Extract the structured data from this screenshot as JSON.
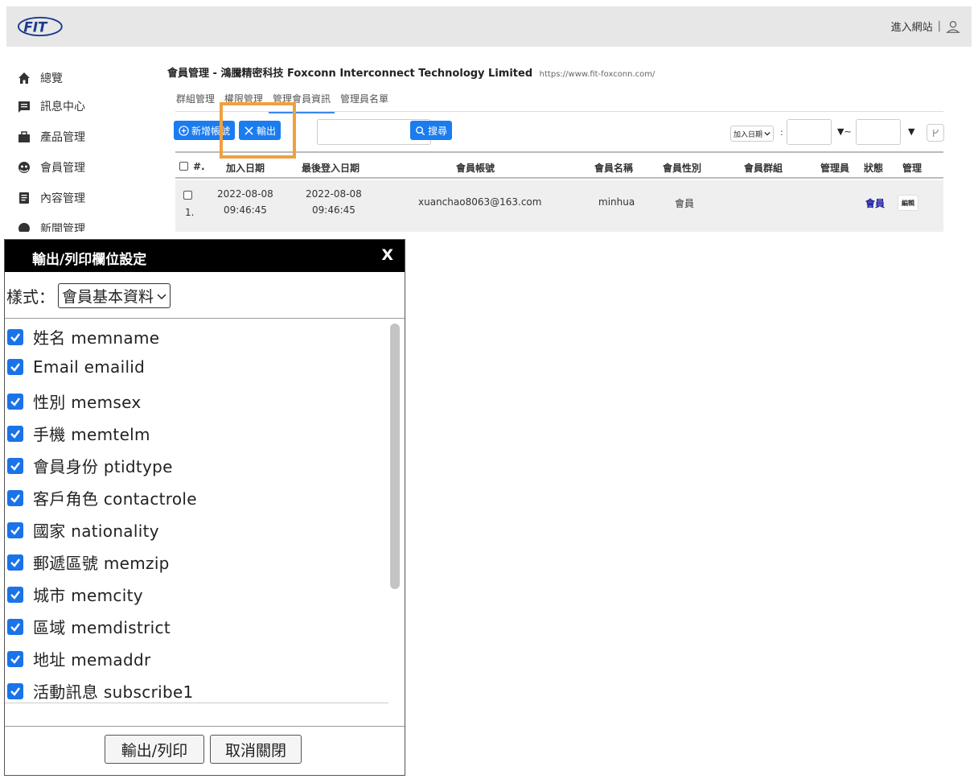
{
  "header": {
    "enter_site": "進入網站",
    "separator": "|"
  },
  "sidebar": {
    "items": [
      {
        "label": "總覽",
        "icon": "home-icon"
      },
      {
        "label": "訊息中心",
        "icon": "message-icon"
      },
      {
        "label": "產品管理",
        "icon": "briefcase-icon"
      },
      {
        "label": "會員管理",
        "icon": "member-icon"
      },
      {
        "label": "內容管理",
        "icon": "document-icon"
      },
      {
        "label": "新聞管理",
        "icon": "news-icon"
      }
    ]
  },
  "main": {
    "org_title": "會員管理 - 鴻騰精密科技 Foxconn Interconnect Technology Limited",
    "org_url": "https://www.fit-foxconn.com/",
    "tabs": [
      {
        "label": "群組管理",
        "active": false
      },
      {
        "label": "權限管理",
        "active": false
      },
      {
        "label": "管理會員資訊",
        "active": true
      },
      {
        "label": "管理員名單",
        "active": false
      }
    ],
    "toolbar": {
      "add_label": "新增帳號",
      "export_label": "輸出",
      "search_label": "搜尋",
      "date_select": "加入日期",
      "colon": ":",
      "arrow_tilde": "▼~",
      "arrow": "▼"
    },
    "table": {
      "headers": [
        "#.",
        "加入日期",
        "最後登入日期",
        "會員帳號",
        "會員名稱",
        "會員性別",
        "會員群組",
        "管理員",
        "狀態",
        "管理"
      ],
      "rows": [
        {
          "index": "1.",
          "join_date": "2022-08-08",
          "join_time": "09:46:45",
          "last_login_date": "2022-08-08",
          "last_login_time": "09:46:45",
          "account": "xuanchao8063@163.com",
          "name": "minhua",
          "gender": "會員",
          "group": "",
          "admin": "",
          "status": "會員",
          "action": "編輯"
        }
      ]
    }
  },
  "dialog": {
    "title": "輸出/列印欄位設定",
    "close": "X",
    "style_label": "樣式：",
    "style_value": "會員基本資料",
    "fields": [
      {
        "label": "姓名 memname",
        "checked": true
      },
      {
        "label": "Email emailid",
        "checked": true
      },
      {
        "label": "性別 memsex",
        "checked": true
      },
      {
        "label": "手機 memtelm",
        "checked": true
      },
      {
        "label": "會員身份 ptidtype",
        "checked": true
      },
      {
        "label": "客戶角色 contactrole",
        "checked": true
      },
      {
        "label": "國家 nationality",
        "checked": true
      },
      {
        "label": "郵遞區號 memzip",
        "checked": true
      },
      {
        "label": "城市 memcity",
        "checked": true
      },
      {
        "label": "區域 memdistrict",
        "checked": true
      },
      {
        "label": "地址 memaddr",
        "checked": true
      },
      {
        "label": "活動訊息 subscribe1",
        "checked": true
      }
    ],
    "export_button": "輸出/列印",
    "cancel_button": "取消關閉"
  },
  "colors": {
    "accent": "#1b7cf0",
    "highlight": "#f0a040",
    "status_link": "#1a1aa0"
  }
}
